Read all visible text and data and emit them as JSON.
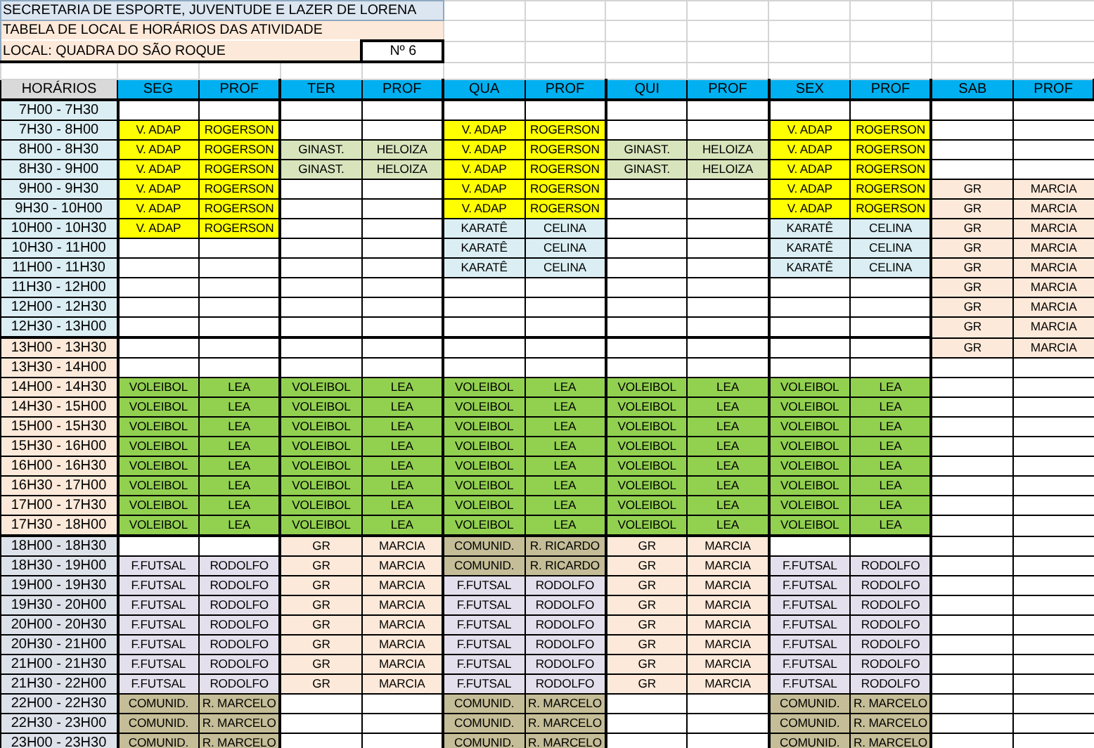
{
  "header": {
    "title": "SECRETARIA DE ESPORTE, JUVENTUDE E LAZER DE LORENA",
    "subtitle": "TABELA DE LOCAL E HORÁRIOS DAS ATIVIDADE",
    "location": "LOCAL: QUADRA DO SÃO ROQUE",
    "number": "Nº 6"
  },
  "columns": [
    "HORÁRIOS",
    "SEG",
    "PROF",
    "TER",
    "PROF",
    "QUA",
    "PROF",
    "QUI",
    "PROF",
    "SEX",
    "PROF",
    "SAB",
    "PROF"
  ],
  "rows": [
    {
      "time": "7H00 - 7H30",
      "color": "#dbeef4",
      "slots": [
        {
          "kind": "empty"
        },
        {
          "kind": "empty"
        },
        {
          "kind": "empty"
        },
        {
          "kind": "empty"
        },
        {
          "kind": "empty"
        },
        {
          "kind": "empty"
        }
      ]
    },
    {
      "time": "7H30 - 8H00",
      "color": "#dbeef4",
      "slots": [
        {
          "kind": "vadap",
          "activity": "V. ADAP",
          "teacher": "ROGERSON"
        },
        {
          "kind": "empty"
        },
        {
          "kind": "vadap",
          "activity": "V. ADAP",
          "teacher": "ROGERSON"
        },
        {
          "kind": "empty"
        },
        {
          "kind": "vadap",
          "activity": "V. ADAP",
          "teacher": "ROGERSON"
        },
        {
          "kind": "empty"
        }
      ]
    },
    {
      "time": "8H00 - 8H30",
      "color": "#dbeef4",
      "slots": [
        {
          "kind": "vadap",
          "activity": "V. ADAP",
          "teacher": "ROGERSON"
        },
        {
          "kind": "ginastica",
          "activity": "GINAST.",
          "teacher": "HELOIZA"
        },
        {
          "kind": "vadap",
          "activity": "V. ADAP",
          "teacher": "ROGERSON"
        },
        {
          "kind": "ginastica",
          "activity": "GINAST.",
          "teacher": "HELOIZA"
        },
        {
          "kind": "vadap",
          "activity": "V. ADAP",
          "teacher": "ROGERSON"
        },
        {
          "kind": "empty"
        }
      ]
    },
    {
      "time": "8H30 - 9H00",
      "color": "#dbeef4",
      "slots": [
        {
          "kind": "vadap",
          "activity": "V. ADAP",
          "teacher": "ROGERSON"
        },
        {
          "kind": "ginastica",
          "activity": "GINAST.",
          "teacher": "HELOIZA"
        },
        {
          "kind": "vadap",
          "activity": "V. ADAP",
          "teacher": "ROGERSON"
        },
        {
          "kind": "ginastica",
          "activity": "GINAST.",
          "teacher": "HELOIZA"
        },
        {
          "kind": "vadap",
          "activity": "V. ADAP",
          "teacher": "ROGERSON"
        },
        {
          "kind": "empty"
        }
      ]
    },
    {
      "time": "9H00 - 9H30",
      "color": "#dbeef4",
      "slots": [
        {
          "kind": "vadap",
          "activity": "V. ADAP",
          "teacher": "ROGERSON"
        },
        {
          "kind": "empty"
        },
        {
          "kind": "vadap",
          "activity": "V. ADAP",
          "teacher": "ROGERSON"
        },
        {
          "kind": "empty"
        },
        {
          "kind": "vadap",
          "activity": "V. ADAP",
          "teacher": "ROGERSON"
        },
        {
          "kind": "gr",
          "activity": "GR",
          "teacher": "MARCIA"
        }
      ]
    },
    {
      "time": "9H30 - 10H00",
      "color": "#dbeef4",
      "slots": [
        {
          "kind": "vadap",
          "activity": "V. ADAP",
          "teacher": "ROGERSON"
        },
        {
          "kind": "empty"
        },
        {
          "kind": "vadap",
          "activity": "V. ADAP",
          "teacher": "ROGERSON"
        },
        {
          "kind": "empty"
        },
        {
          "kind": "vadap",
          "activity": "V. ADAP",
          "teacher": "ROGERSON"
        },
        {
          "kind": "gr",
          "activity": "GR",
          "teacher": "MARCIA"
        }
      ]
    },
    {
      "time": "10H00 - 10H30",
      "color": "#dbeef4",
      "slots": [
        {
          "kind": "vadap",
          "activity": "V. ADAP",
          "teacher": "ROGERSON"
        },
        {
          "kind": "empty"
        },
        {
          "kind": "karate",
          "activity": "KARATÊ",
          "teacher": "CELINA"
        },
        {
          "kind": "empty"
        },
        {
          "kind": "karate",
          "activity": "KARATÊ",
          "teacher": "CELINA"
        },
        {
          "kind": "gr",
          "activity": "GR",
          "teacher": "MARCIA"
        }
      ]
    },
    {
      "time": "10H30 - 11H00",
      "color": "#dbeef4",
      "slots": [
        {
          "kind": "empty"
        },
        {
          "kind": "empty"
        },
        {
          "kind": "karate",
          "activity": "KARATÊ",
          "teacher": "CELINA"
        },
        {
          "kind": "empty"
        },
        {
          "kind": "karate",
          "activity": "KARATÊ",
          "teacher": "CELINA"
        },
        {
          "kind": "gr",
          "activity": "GR",
          "teacher": "MARCIA"
        }
      ]
    },
    {
      "time": "11H00 - 11H30",
      "color": "#dbeef4",
      "slots": [
        {
          "kind": "empty"
        },
        {
          "kind": "empty"
        },
        {
          "kind": "karate",
          "activity": "KARATÊ",
          "teacher": "CELINA"
        },
        {
          "kind": "empty"
        },
        {
          "kind": "karate",
          "activity": "KARATÊ",
          "teacher": "CELINA"
        },
        {
          "kind": "gr",
          "activity": "GR",
          "teacher": "MARCIA"
        }
      ]
    },
    {
      "time": "11H30 - 12H00",
      "color": "#dbeef4",
      "slots": [
        {
          "kind": "empty"
        },
        {
          "kind": "empty"
        },
        {
          "kind": "empty"
        },
        {
          "kind": "empty"
        },
        {
          "kind": "empty"
        },
        {
          "kind": "gr",
          "activity": "GR",
          "teacher": "MARCIA"
        }
      ]
    },
    {
      "time": "12H00 - 12H30",
      "color": "#dbeef4",
      "slots": [
        {
          "kind": "empty"
        },
        {
          "kind": "empty"
        },
        {
          "kind": "empty"
        },
        {
          "kind": "empty"
        },
        {
          "kind": "empty"
        },
        {
          "kind": "gr",
          "activity": "GR",
          "teacher": "MARCIA"
        }
      ]
    },
    {
      "time": "12H30 - 13H00",
      "color": "#dbeef4",
      "slots": [
        {
          "kind": "empty"
        },
        {
          "kind": "empty"
        },
        {
          "kind": "empty"
        },
        {
          "kind": "empty"
        },
        {
          "kind": "empty"
        },
        {
          "kind": "gr",
          "activity": "GR",
          "teacher": "MARCIA"
        }
      ]
    },
    {
      "time": "13H00 - 13H30",
      "color": "#fde9d9",
      "slots": [
        {
          "kind": "empty"
        },
        {
          "kind": "empty"
        },
        {
          "kind": "empty"
        },
        {
          "kind": "empty"
        },
        {
          "kind": "empty"
        },
        {
          "kind": "gr",
          "activity": "GR",
          "teacher": "MARCIA"
        }
      ]
    },
    {
      "time": "13H30 - 14H00",
      "color": "#fde9d9",
      "slots": [
        {
          "kind": "empty"
        },
        {
          "kind": "empty"
        },
        {
          "kind": "empty"
        },
        {
          "kind": "empty"
        },
        {
          "kind": "empty"
        },
        {
          "kind": "empty"
        }
      ]
    },
    {
      "time": "14H00 - 14H30",
      "color": "#fde9d9",
      "slots": [
        {
          "kind": "volei",
          "activity": "VOLEIBOL",
          "teacher": "LEA"
        },
        {
          "kind": "volei",
          "activity": "VOLEIBOL",
          "teacher": "LEA"
        },
        {
          "kind": "volei",
          "activity": "VOLEIBOL",
          "teacher": "LEA"
        },
        {
          "kind": "volei",
          "activity": "VOLEIBOL",
          "teacher": "LEA"
        },
        {
          "kind": "volei",
          "activity": "VOLEIBOL",
          "teacher": "LEA"
        },
        {
          "kind": "empty"
        }
      ]
    },
    {
      "time": "14H30 - 15H00",
      "color": "#fde9d9",
      "slots": [
        {
          "kind": "volei",
          "activity": "VOLEIBOL",
          "teacher": "LEA"
        },
        {
          "kind": "volei",
          "activity": "VOLEIBOL",
          "teacher": "LEA"
        },
        {
          "kind": "volei",
          "activity": "VOLEIBOL",
          "teacher": "LEA"
        },
        {
          "kind": "volei",
          "activity": "VOLEIBOL",
          "teacher": "LEA"
        },
        {
          "kind": "volei",
          "activity": "VOLEIBOL",
          "teacher": "LEA"
        },
        {
          "kind": "empty"
        }
      ]
    },
    {
      "time": "15H00 - 15H30",
      "color": "#fde9d9",
      "slots": [
        {
          "kind": "volei",
          "activity": "VOLEIBOL",
          "teacher": "LEA"
        },
        {
          "kind": "volei",
          "activity": "VOLEIBOL",
          "teacher": "LEA"
        },
        {
          "kind": "volei",
          "activity": "VOLEIBOL",
          "teacher": "LEA"
        },
        {
          "kind": "volei",
          "activity": "VOLEIBOL",
          "teacher": "LEA"
        },
        {
          "kind": "volei",
          "activity": "VOLEIBOL",
          "teacher": "LEA"
        },
        {
          "kind": "empty"
        }
      ]
    },
    {
      "time": "15H30 - 16H00",
      "color": "#fde9d9",
      "slots": [
        {
          "kind": "volei",
          "activity": "VOLEIBOL",
          "teacher": "LEA"
        },
        {
          "kind": "volei",
          "activity": "VOLEIBOL",
          "teacher": "LEA"
        },
        {
          "kind": "volei",
          "activity": "VOLEIBOL",
          "teacher": "LEA"
        },
        {
          "kind": "volei",
          "activity": "VOLEIBOL",
          "teacher": "LEA"
        },
        {
          "kind": "volei",
          "activity": "VOLEIBOL",
          "teacher": "LEA"
        },
        {
          "kind": "empty"
        }
      ]
    },
    {
      "time": "16H00 - 16H30",
      "color": "#fde9d9",
      "slots": [
        {
          "kind": "volei",
          "activity": "VOLEIBOL",
          "teacher": "LEA"
        },
        {
          "kind": "volei",
          "activity": "VOLEIBOL",
          "teacher": "LEA"
        },
        {
          "kind": "volei",
          "activity": "VOLEIBOL",
          "teacher": "LEA"
        },
        {
          "kind": "volei",
          "activity": "VOLEIBOL",
          "teacher": "LEA"
        },
        {
          "kind": "volei",
          "activity": "VOLEIBOL",
          "teacher": "LEA"
        },
        {
          "kind": "empty"
        }
      ]
    },
    {
      "time": "16H30 - 17H00",
      "color": "#fde9d9",
      "slots": [
        {
          "kind": "volei",
          "activity": "VOLEIBOL",
          "teacher": "LEA"
        },
        {
          "kind": "volei",
          "activity": "VOLEIBOL",
          "teacher": "LEA"
        },
        {
          "kind": "volei",
          "activity": "VOLEIBOL",
          "teacher": "LEA"
        },
        {
          "kind": "volei",
          "activity": "VOLEIBOL",
          "teacher": "LEA"
        },
        {
          "kind": "volei",
          "activity": "VOLEIBOL",
          "teacher": "LEA"
        },
        {
          "kind": "empty"
        }
      ]
    },
    {
      "time": "17H00 - 17H30",
      "color": "#fde9d9",
      "slots": [
        {
          "kind": "volei",
          "activity": "VOLEIBOL",
          "teacher": "LEA"
        },
        {
          "kind": "volei",
          "activity": "VOLEIBOL",
          "teacher": "LEA"
        },
        {
          "kind": "volei",
          "activity": "VOLEIBOL",
          "teacher": "LEA"
        },
        {
          "kind": "volei",
          "activity": "VOLEIBOL",
          "teacher": "LEA"
        },
        {
          "kind": "volei",
          "activity": "VOLEIBOL",
          "teacher": "LEA"
        },
        {
          "kind": "empty"
        }
      ]
    },
    {
      "time": "17H30 - 18H00",
      "color": "#fde9d9",
      "slots": [
        {
          "kind": "volei",
          "activity": "VOLEIBOL",
          "teacher": "LEA"
        },
        {
          "kind": "volei",
          "activity": "VOLEIBOL",
          "teacher": "LEA"
        },
        {
          "kind": "volei",
          "activity": "VOLEIBOL",
          "teacher": "LEA"
        },
        {
          "kind": "volei",
          "activity": "VOLEIBOL",
          "teacher": "LEA"
        },
        {
          "kind": "volei",
          "activity": "VOLEIBOL",
          "teacher": "LEA"
        },
        {
          "kind": "empty"
        }
      ]
    },
    {
      "time": "18H00 - 18H30",
      "color": "#dde2ea",
      "slots": [
        {
          "kind": "empty"
        },
        {
          "kind": "gr",
          "activity": "GR",
          "teacher": "MARCIA"
        },
        {
          "kind": "comunid",
          "activity": "COMUNID.",
          "teacher": "R. RICARDO"
        },
        {
          "kind": "gr",
          "activity": "GR",
          "teacher": "MARCIA"
        },
        {
          "kind": "empty"
        },
        {
          "kind": "empty"
        }
      ]
    },
    {
      "time": "18H30 - 19H00",
      "color": "#dde2ea",
      "slots": [
        {
          "kind": "futsal",
          "activity": "F.FUTSAL",
          "teacher": "RODOLFO"
        },
        {
          "kind": "gr",
          "activity": "GR",
          "teacher": "MARCIA"
        },
        {
          "kind": "comunid",
          "activity": "COMUNID.",
          "teacher": "R. RICARDO"
        },
        {
          "kind": "gr",
          "activity": "GR",
          "teacher": "MARCIA"
        },
        {
          "kind": "futsal",
          "activity": "F.FUTSAL",
          "teacher": "RODOLFO"
        },
        {
          "kind": "empty"
        }
      ]
    },
    {
      "time": "19H00 - 19H30",
      "color": "#dde2ea",
      "slots": [
        {
          "kind": "futsal",
          "activity": "F.FUTSAL",
          "teacher": "RODOLFO"
        },
        {
          "kind": "gr",
          "activity": "GR",
          "teacher": "MARCIA"
        },
        {
          "kind": "futsal",
          "activity": "F.FUTSAL",
          "teacher": "RODOLFO"
        },
        {
          "kind": "gr",
          "activity": "GR",
          "teacher": "MARCIA"
        },
        {
          "kind": "futsal",
          "activity": "F.FUTSAL",
          "teacher": "RODOLFO"
        },
        {
          "kind": "empty"
        }
      ]
    },
    {
      "time": "19H30 - 20H00",
      "color": "#dde2ea",
      "slots": [
        {
          "kind": "futsal",
          "activity": "F.FUTSAL",
          "teacher": "RODOLFO"
        },
        {
          "kind": "gr",
          "activity": "GR",
          "teacher": "MARCIA"
        },
        {
          "kind": "futsal",
          "activity": "F.FUTSAL",
          "teacher": "RODOLFO"
        },
        {
          "kind": "gr",
          "activity": "GR",
          "teacher": "MARCIA"
        },
        {
          "kind": "futsal",
          "activity": "F.FUTSAL",
          "teacher": "RODOLFO"
        },
        {
          "kind": "empty"
        }
      ]
    },
    {
      "time": "20H00 - 20H30",
      "color": "#dde2ea",
      "slots": [
        {
          "kind": "futsal",
          "activity": "F.FUTSAL",
          "teacher": "RODOLFO"
        },
        {
          "kind": "gr",
          "activity": "GR",
          "teacher": "MARCIA"
        },
        {
          "kind": "futsal",
          "activity": "F.FUTSAL",
          "teacher": "RODOLFO"
        },
        {
          "kind": "gr",
          "activity": "GR",
          "teacher": "MARCIA"
        },
        {
          "kind": "futsal",
          "activity": "F.FUTSAL",
          "teacher": "RODOLFO"
        },
        {
          "kind": "empty"
        }
      ]
    },
    {
      "time": "20H30 - 21H00",
      "color": "#dde2ea",
      "slots": [
        {
          "kind": "futsal",
          "activity": "F.FUTSAL",
          "teacher": "RODOLFO"
        },
        {
          "kind": "gr",
          "activity": "GR",
          "teacher": "MARCIA"
        },
        {
          "kind": "futsal",
          "activity": "F.FUTSAL",
          "teacher": "RODOLFO"
        },
        {
          "kind": "gr",
          "activity": "GR",
          "teacher": "MARCIA"
        },
        {
          "kind": "futsal",
          "activity": "F.FUTSAL",
          "teacher": "RODOLFO"
        },
        {
          "kind": "empty"
        }
      ]
    },
    {
      "time": "21H00 - 21H30",
      "color": "#dde2ea",
      "slots": [
        {
          "kind": "futsal",
          "activity": "F.FUTSAL",
          "teacher": "RODOLFO"
        },
        {
          "kind": "gr",
          "activity": "GR",
          "teacher": "MARCIA"
        },
        {
          "kind": "futsal",
          "activity": "F.FUTSAL",
          "teacher": "RODOLFO"
        },
        {
          "kind": "gr",
          "activity": "GR",
          "teacher": "MARCIA"
        },
        {
          "kind": "futsal",
          "activity": "F.FUTSAL",
          "teacher": "RODOLFO"
        },
        {
          "kind": "empty"
        }
      ]
    },
    {
      "time": "21H30 - 22H00",
      "color": "#dde2ea",
      "slots": [
        {
          "kind": "futsal",
          "activity": "F.FUTSAL",
          "teacher": "RODOLFO"
        },
        {
          "kind": "gr",
          "activity": "GR",
          "teacher": "MARCIA"
        },
        {
          "kind": "futsal",
          "activity": "F.FUTSAL",
          "teacher": "RODOLFO"
        },
        {
          "kind": "gr",
          "activity": "GR",
          "teacher": "MARCIA"
        },
        {
          "kind": "futsal",
          "activity": "F.FUTSAL",
          "teacher": "RODOLFO"
        },
        {
          "kind": "empty"
        }
      ]
    },
    {
      "time": "22H00 - 22H30",
      "color": "#dde2ea",
      "slots": [
        {
          "kind": "comunid",
          "activity": "COMUNID.",
          "teacher": "R. MARCELO"
        },
        {
          "kind": "empty"
        },
        {
          "kind": "comunid",
          "activity": "COMUNID.",
          "teacher": "R. MARCELO"
        },
        {
          "kind": "empty"
        },
        {
          "kind": "comunid",
          "activity": "COMUNID.",
          "teacher": "R. MARCELO"
        },
        {
          "kind": "empty"
        }
      ]
    },
    {
      "time": "22H30 - 23H00",
      "color": "#dde2ea",
      "slots": [
        {
          "kind": "comunid",
          "activity": "COMUNID.",
          "teacher": "R. MARCELO"
        },
        {
          "kind": "empty"
        },
        {
          "kind": "comunid",
          "activity": "COMUNID.",
          "teacher": "R. MARCELO"
        },
        {
          "kind": "empty"
        },
        {
          "kind": "comunid",
          "activity": "COMUNID.",
          "teacher": "R. MARCELO"
        },
        {
          "kind": "empty"
        }
      ]
    },
    {
      "time": "23H00 - 23H30",
      "color": "#dde2ea",
      "slots": [
        {
          "kind": "comunid",
          "activity": "COMUNID.",
          "teacher": "R. MARCELO"
        },
        {
          "kind": "empty"
        },
        {
          "kind": "comunid",
          "activity": "COMUNID.",
          "teacher": "R. MARCELO"
        },
        {
          "kind": "empty"
        },
        {
          "kind": "comunid",
          "activity": "COMUNID.",
          "teacher": "R. MARCELO"
        },
        {
          "kind": "empty"
        }
      ]
    }
  ]
}
